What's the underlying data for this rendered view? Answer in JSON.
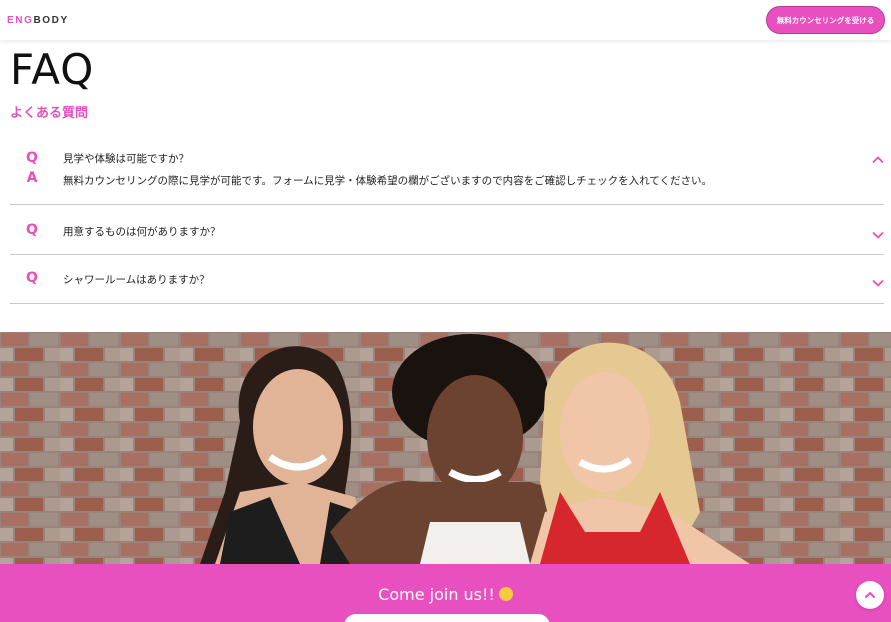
{
  "header": {
    "logo_accent": "ENG",
    "logo_rest": "BODY",
    "cta_label": "無料カウンセリングを受ける"
  },
  "faq": {
    "title": "FAQ",
    "subtitle": "よくある質問",
    "q_mark": "Q",
    "a_mark": "A",
    "items": [
      {
        "question": "見学や体験は可能ですか？",
        "answer": "無料カウンセリングの際に見学が可能です。フォームに見学・体験希望の欄がございますので内容をご確認しチェックを入れてください。",
        "expanded": true
      },
      {
        "question": "用意するものは何がありますか？",
        "answer": "",
        "expanded": false
      },
      {
        "question": "シャワールームはありますか？",
        "answer": "",
        "expanded": false
      }
    ]
  },
  "join": {
    "text": "Come join us!!"
  },
  "colors": {
    "accent": "#e84fbf",
    "accent_border": "#b8379a",
    "divider": "#c8c8c8"
  },
  "icons": {
    "collapse": "chevron-up-icon",
    "expand": "chevron-down-icon",
    "scroll_top": "arrow-up-icon",
    "emoji": "smile-emoji-icon"
  }
}
